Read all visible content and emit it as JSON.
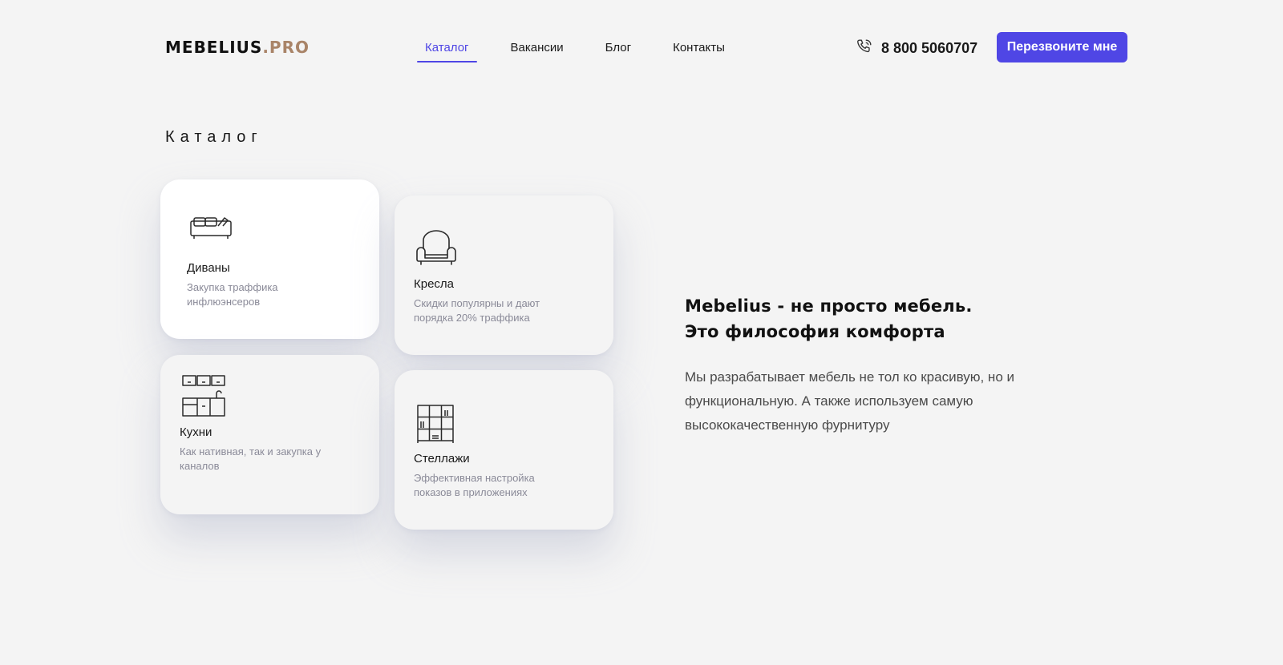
{
  "header": {
    "logo_main": "MEBELIUS",
    "logo_accent": ".PRO",
    "nav": [
      {
        "label": "Каталог",
        "active": true
      },
      {
        "label": "Вакансии",
        "active": false
      },
      {
        "label": "Блог",
        "active": false
      },
      {
        "label": "Контакты",
        "active": false
      }
    ],
    "phone": "8 800 5060707",
    "phone_icon": "phone-icon",
    "callback_label": "Перезвоните мне"
  },
  "catalog": {
    "title": "Каталог",
    "cards": [
      {
        "name": "Диваны",
        "desc": "Закупка траффика инфлюэнсеров",
        "icon": "sofa-icon"
      },
      {
        "name": "Кресла",
        "desc": "Скидки популярны и дают порядка 20% траффика",
        "icon": "armchair-icon"
      },
      {
        "name": "Кухни",
        "desc": "Как нативная, так и закупка у каналов",
        "icon": "kitchen-icon"
      },
      {
        "name": "Стеллажи",
        "desc": "Эффективная настройка показов в приложениях",
        "icon": "shelving-icon"
      }
    ]
  },
  "about": {
    "title_line1": "Mebelius - не просто мебель.",
    "title_line2": "Это философия комфорта",
    "text": "Мы разрабатывает мебель не тол ко красивую, но и функциональную. А также используем самую высококачественную фурнитуру"
  },
  "colors": {
    "accent": "#4f46e5",
    "logo_accent": "#a98468",
    "background": "#f4f4f4"
  }
}
